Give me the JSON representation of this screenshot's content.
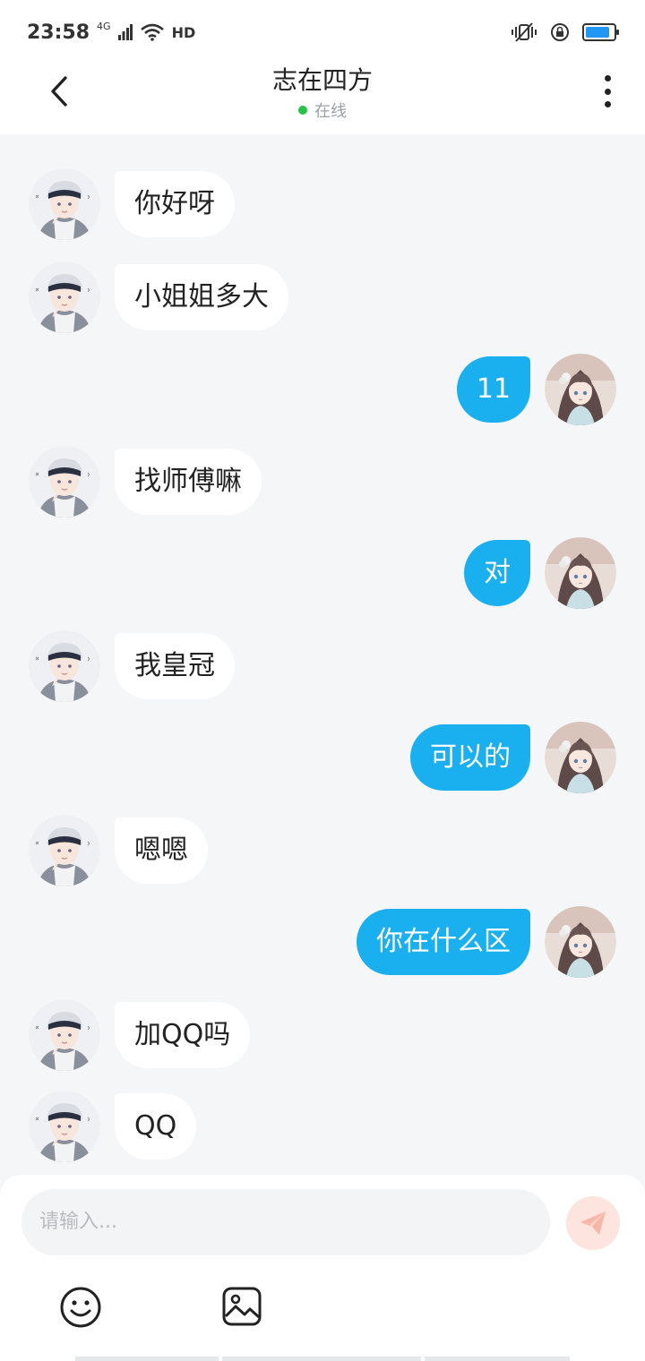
{
  "status_bar": {
    "time": "23:58",
    "network": "4G",
    "hd": "HD",
    "battery_level": 0.85,
    "accent_color": "#2196f3"
  },
  "header": {
    "title": "志在四方",
    "status": "在线",
    "status_color": "#27c246",
    "back_icon": "chevron-left-icon",
    "more_icon": "more-vertical-icon"
  },
  "messages": [
    {
      "side": "left",
      "text": "你好呀"
    },
    {
      "side": "left",
      "text": "小姐姐多大"
    },
    {
      "side": "right",
      "text": "11"
    },
    {
      "side": "left",
      "text": "找师傅嘛"
    },
    {
      "side": "right",
      "text": "对"
    },
    {
      "side": "left",
      "text": "我皇冠"
    },
    {
      "side": "right",
      "text": "可以的"
    },
    {
      "side": "left",
      "text": "嗯嗯"
    },
    {
      "side": "right",
      "text": "你在什么区"
    },
    {
      "side": "left",
      "text": "加QQ吗"
    },
    {
      "side": "left",
      "text": "QQ"
    }
  ],
  "input": {
    "placeholder": "请输入...",
    "send_icon": "paper-plane-icon",
    "emoji_icon": "smiley-icon",
    "image_icon": "image-icon"
  },
  "colors": {
    "sent_bubble": "#1ab0ef",
    "received_bubble": "#ffffff",
    "chat_background": "#f4f6f7"
  }
}
